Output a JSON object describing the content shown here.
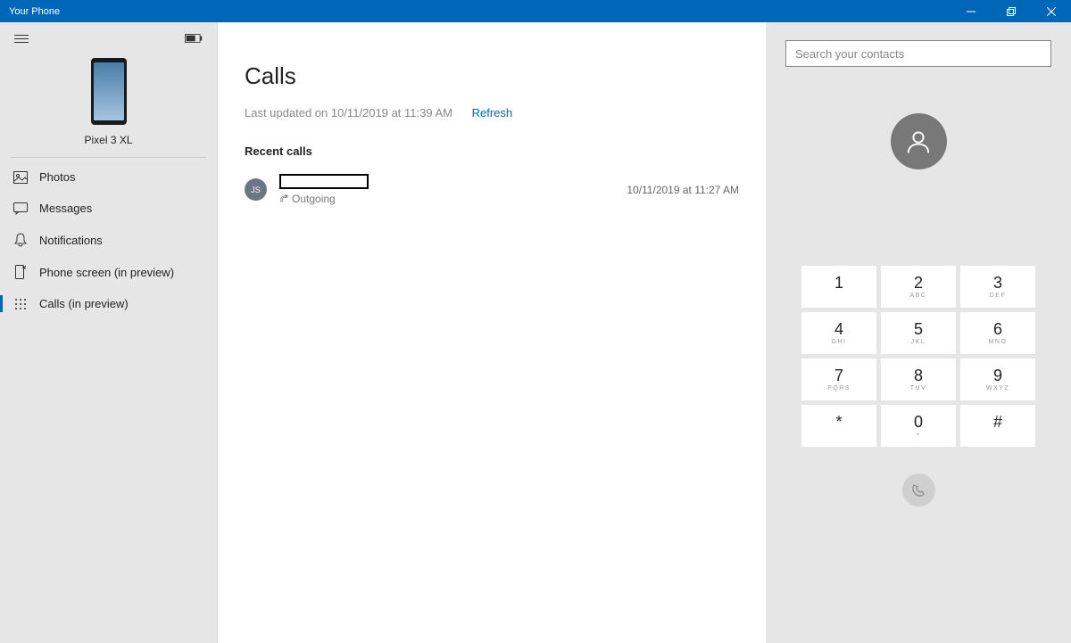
{
  "window": {
    "title": "Your Phone"
  },
  "sidebar": {
    "device_name": "Pixel 3 XL",
    "items": [
      {
        "label": "Photos",
        "icon": "photos-icon"
      },
      {
        "label": "Messages",
        "icon": "messages-icon"
      },
      {
        "label": "Notifications",
        "icon": "notifications-icon"
      },
      {
        "label": "Phone screen (in preview)",
        "icon": "phone-screen-icon"
      },
      {
        "label": "Calls (in preview)",
        "icon": "dialpad-icon"
      }
    ]
  },
  "main": {
    "title": "Calls",
    "updated_text": "Last updated on 10/11/2019 at 11:39 AM",
    "refresh_label": "Refresh",
    "section_title": "Recent calls",
    "calls": [
      {
        "initials": "JS",
        "name_redacted": true,
        "type": "Outgoing",
        "timestamp": "10/11/2019 at 11:27 AM"
      }
    ]
  },
  "rightpanel": {
    "search_placeholder": "Search your contacts",
    "keys": [
      {
        "num": "1",
        "letters": ""
      },
      {
        "num": "2",
        "letters": "ABC"
      },
      {
        "num": "3",
        "letters": "DEF"
      },
      {
        "num": "4",
        "letters": "GHI"
      },
      {
        "num": "5",
        "letters": "JKL"
      },
      {
        "num": "6",
        "letters": "MNO"
      },
      {
        "num": "7",
        "letters": "PQRS"
      },
      {
        "num": "8",
        "letters": "TUV"
      },
      {
        "num": "9",
        "letters": "WXYZ"
      },
      {
        "num": "*",
        "letters": ""
      },
      {
        "num": "0",
        "letters": "+"
      },
      {
        "num": "#",
        "letters": ""
      }
    ]
  }
}
